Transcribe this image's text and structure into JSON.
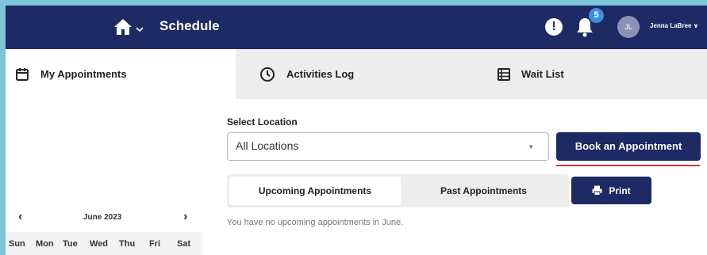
{
  "header": {
    "title": "Schedule",
    "alert_glyph": "!",
    "notification_count": "5",
    "avatar_initials": "JL",
    "user_name": "Jenna LaBree ∨",
    "home_icon": "home-icon",
    "colors": {
      "nav": "#1d2a63",
      "badge": "#3a8fe0",
      "accent_underline": "#d9333c",
      "frame": "#7dc5d8"
    }
  },
  "tabs": [
    {
      "label": "My Appointments",
      "icon": "calendar-icon",
      "active": true
    },
    {
      "label": "Activities Log",
      "icon": "clock-icon",
      "active": false
    },
    {
      "label": "Wait List",
      "icon": "list-icon",
      "active": false
    }
  ],
  "calendar": {
    "prev": "‹",
    "next": "›",
    "month": "June 2023",
    "days": [
      "Sun",
      "Mon",
      "Tue",
      "Wed",
      "Thu",
      "Fri",
      "Sat"
    ]
  },
  "location": {
    "label": "Select Location",
    "selected": "All Locations"
  },
  "actions": {
    "book": "Book an Appointment",
    "print": "Print"
  },
  "appointment_tabs": {
    "upcoming": "Upcoming Appointments",
    "past": "Past Appointments"
  },
  "empty_message": "You have no upcoming appointments in June."
}
